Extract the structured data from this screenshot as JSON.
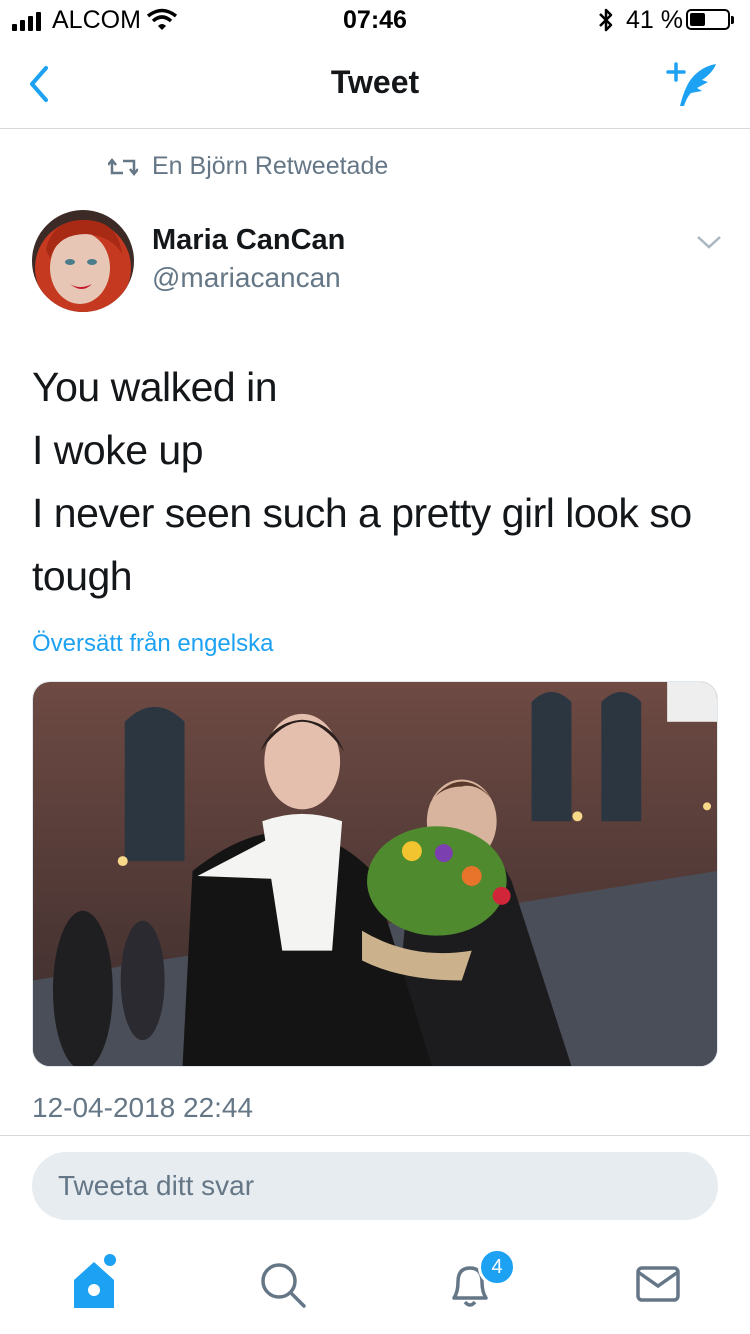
{
  "status_bar": {
    "carrier": "ALCOM",
    "time": "07:46",
    "battery_percent": "41 %",
    "battery_level": 0.41,
    "signal_bars": 4
  },
  "nav": {
    "title": "Tweet",
    "back_icon": "chevron-left-icon",
    "compose_icon": "compose-tweet-icon"
  },
  "tweet": {
    "retweet_context": "En Björn Retweetade",
    "author_name": "Maria CanCan",
    "author_handle": "@mariacancan",
    "text_lines": [
      "You walked in",
      "I woke up",
      "I never seen such a pretty girl look so",
      "tough"
    ],
    "translate_label": "Översätt från engelska",
    "timestamp": "12-04-2018 22:44"
  },
  "reply": {
    "placeholder": "Tweeta ditt svar"
  },
  "tab_bar": {
    "items": [
      "home-icon",
      "search-icon",
      "notifications-icon",
      "messages-icon"
    ],
    "notification_count": "4"
  },
  "colors": {
    "accent": "#1da1f2",
    "secondary_text": "#657786",
    "primary_text": "#14171a"
  }
}
